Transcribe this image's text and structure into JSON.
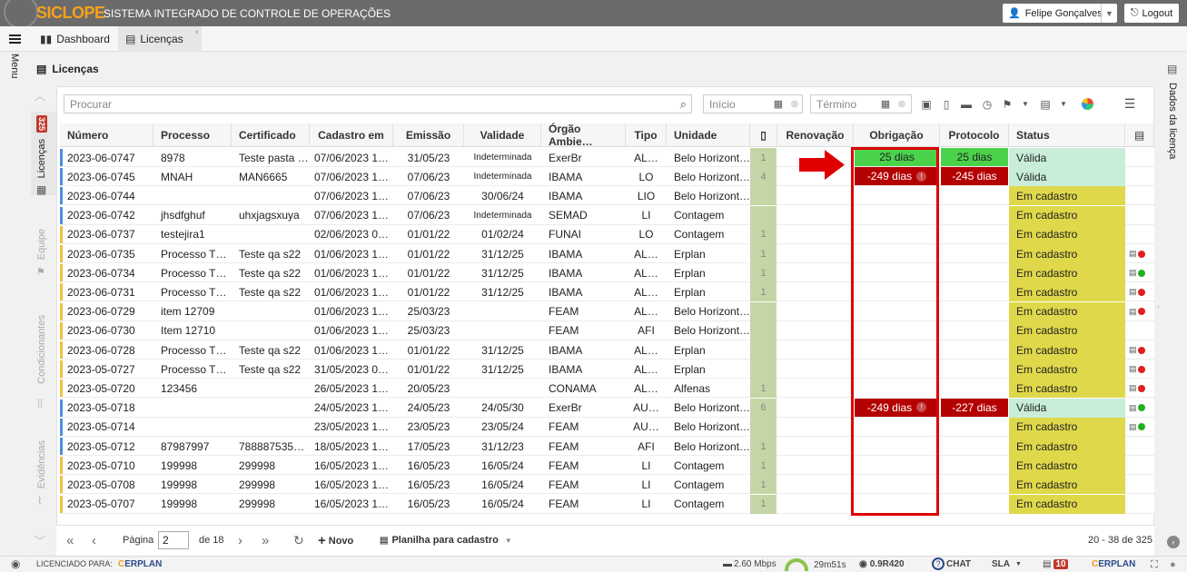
{
  "header": {
    "logo": "SICLOPE",
    "system_title": "SISTEMA INTEGRADO DE CONTROLE DE OPERAÇÕES",
    "user": "Felipe Gonçalves",
    "logout": "Logout"
  },
  "tabs": [
    {
      "label": "Dashboard"
    },
    {
      "label": "Licenças"
    }
  ],
  "menu_label": "Menu",
  "page_title": "Licenças",
  "left_panel": {
    "licencas": "Licenças",
    "licencas_badge": "325",
    "equipe": "Equipe",
    "condicionantes": "Condicionantes",
    "evidencias": "Evidências"
  },
  "right_panel": {
    "label": "Dados da licença"
  },
  "search": {
    "placeholder": "Procurar"
  },
  "filters": {
    "inicio": "Início",
    "termino": "Término"
  },
  "columns": [
    "Número",
    "Processo",
    "Certificado",
    "Cadastro em",
    "Emissão",
    "Validade",
    "Órgão Ambie…",
    "Tipo",
    "Unidade",
    "",
    "Renovação",
    "Obrigação",
    "Protocolo",
    "Status"
  ],
  "rows": [
    {
      "numero": "2023-06-0747",
      "processo": "8978",
      "certificado": "Teste pasta …",
      "cadastro": "07/06/2023 1…",
      "emissao": "31/05/23",
      "validade": "Indeterminada",
      "orgao": "ExerBr",
      "tipo": "AL…",
      "unidade": "Belo Horizont…",
      "n": "1",
      "obrigacao": "25 dias",
      "protocolo": "25 dias",
      "status": "Válida",
      "bar": "#4a90d9",
      "icon": ""
    },
    {
      "numero": "2023-06-0745",
      "processo": "MNAH",
      "certificado": "MAN6665",
      "cadastro": "07/06/2023 1…",
      "emissao": "07/06/23",
      "validade": "Indeterminada",
      "orgao": "IBAMA",
      "tipo": "LO",
      "unidade": "Belo Horizont…",
      "n": "4",
      "obrigacao": "-249 dias",
      "protocolo": "-245 dias",
      "status": "Válida",
      "bar": "#4a90d9",
      "icon": ""
    },
    {
      "numero": "2023-06-0744",
      "processo": "",
      "certificado": "",
      "cadastro": "07/06/2023 1…",
      "emissao": "07/06/23",
      "validade": "30/06/24",
      "orgao": "IBAMA",
      "tipo": "LIO",
      "unidade": "Belo Horizont…",
      "n": "",
      "obrigacao": "",
      "protocolo": "",
      "status": "Em cadastro",
      "bar": "#4a90d9",
      "icon": ""
    },
    {
      "numero": "2023-06-0742",
      "processo": "jhsdfghuf",
      "certificado": "uhxjagsxuya",
      "cadastro": "07/06/2023 1…",
      "emissao": "07/06/23",
      "validade": "Indeterminada",
      "orgao": "SEMAD",
      "tipo": "LI",
      "unidade": "Contagem",
      "n": "",
      "obrigacao": "",
      "protocolo": "",
      "status": "Em cadastro",
      "bar": "#4a90d9",
      "icon": ""
    },
    {
      "numero": "2023-06-0737",
      "processo": "testejira1",
      "certificado": "",
      "cadastro": "02/06/2023 0…",
      "emissao": "01/01/22",
      "validade": "01/02/24",
      "orgao": "FUNAI",
      "tipo": "LO",
      "unidade": "Contagem",
      "n": "1",
      "obrigacao": "",
      "protocolo": "",
      "status": "Em cadastro",
      "bar": "#f0c040",
      "icon": ""
    },
    {
      "numero": "2023-06-0735",
      "processo": "Processo T…",
      "certificado": "Teste qa s22",
      "cadastro": "01/06/2023 1…",
      "emissao": "01/01/22",
      "validade": "31/12/25",
      "orgao": "IBAMA",
      "tipo": "AL…",
      "unidade": "Erplan",
      "n": "1",
      "obrigacao": "",
      "protocolo": "",
      "status": "Em cadastro",
      "bar": "#f0c040",
      "icon": "red"
    },
    {
      "numero": "2023-06-0734",
      "processo": "Processo T…",
      "certificado": "Teste qa s22",
      "cadastro": "01/06/2023 1…",
      "emissao": "01/01/22",
      "validade": "31/12/25",
      "orgao": "IBAMA",
      "tipo": "AL…",
      "unidade": "Erplan",
      "n": "1",
      "obrigacao": "",
      "protocolo": "",
      "status": "Em cadastro",
      "bar": "#f0c040",
      "icon": "green"
    },
    {
      "numero": "2023-06-0731",
      "processo": "Processo T…",
      "certificado": "Teste qa s22",
      "cadastro": "01/06/2023 1…",
      "emissao": "01/01/22",
      "validade": "31/12/25",
      "orgao": "IBAMA",
      "tipo": "AL…",
      "unidade": "Erplan",
      "n": "1",
      "obrigacao": "",
      "protocolo": "",
      "status": "Em cadastro",
      "bar": "#f0c040",
      "icon": "red"
    },
    {
      "numero": "2023-06-0729",
      "processo": "item 12709",
      "certificado": "",
      "cadastro": "01/06/2023 1…",
      "emissao": "25/03/23",
      "validade": "",
      "orgao": "FEAM",
      "tipo": "AL…",
      "unidade": "Belo Horizont…",
      "n": "",
      "obrigacao": "",
      "protocolo": "",
      "status": "Em cadastro",
      "bar": "#f0c040",
      "icon": "red"
    },
    {
      "numero": "2023-06-0730",
      "processo": "Item 12710",
      "certificado": "",
      "cadastro": "01/06/2023 1…",
      "emissao": "25/03/23",
      "validade": "",
      "orgao": "FEAM",
      "tipo": "AFI",
      "unidade": "Belo Horizont…",
      "n": "",
      "obrigacao": "",
      "protocolo": "",
      "status": "Em cadastro",
      "bar": "#f0c040",
      "icon": ""
    },
    {
      "numero": "2023-06-0728",
      "processo": "Processo T…",
      "certificado": "Teste qa s22",
      "cadastro": "01/06/2023 1…",
      "emissao": "01/01/22",
      "validade": "31/12/25",
      "orgao": "IBAMA",
      "tipo": "AL…",
      "unidade": "Erplan",
      "n": "",
      "obrigacao": "",
      "protocolo": "",
      "status": "Em cadastro",
      "bar": "#f0c040",
      "icon": "red"
    },
    {
      "numero": "2023-05-0727",
      "processo": "Processo T…",
      "certificado": "Teste qa s22",
      "cadastro": "31/05/2023 0…",
      "emissao": "01/01/22",
      "validade": "31/12/25",
      "orgao": "IBAMA",
      "tipo": "AL…",
      "unidade": "Erplan",
      "n": "",
      "obrigacao": "",
      "protocolo": "",
      "status": "Em cadastro",
      "bar": "#f0c040",
      "icon": "red"
    },
    {
      "numero": "2023-05-0720",
      "processo": "123456",
      "certificado": "",
      "cadastro": "26/05/2023 1…",
      "emissao": "20/05/23",
      "validade": "",
      "orgao": "CONAMA",
      "tipo": "AL…",
      "unidade": "Alfenas",
      "n": "1",
      "obrigacao": "",
      "protocolo": "",
      "status": "Em cadastro",
      "bar": "#f0c040",
      "icon": "red"
    },
    {
      "numero": "2023-05-0718",
      "processo": "",
      "certificado": "",
      "cadastro": "24/05/2023 1…",
      "emissao": "24/05/23",
      "validade": "24/05/30",
      "orgao": "ExerBr",
      "tipo": "AU…",
      "unidade": "Belo Horizont…",
      "n": "6",
      "obrigacao": "-249 dias",
      "protocolo": "-227 dias",
      "status": "Válida",
      "bar": "#4a90d9",
      "icon": "green"
    },
    {
      "numero": "2023-05-0714",
      "processo": "",
      "certificado": "",
      "cadastro": "23/05/2023 1…",
      "emissao": "23/05/23",
      "validade": "23/05/24",
      "orgao": "FEAM",
      "tipo": "AU…",
      "unidade": "Belo Horizont…",
      "n": "",
      "obrigacao": "",
      "protocolo": "",
      "status": "Em cadastro",
      "bar": "#4a90d9",
      "icon": "green"
    },
    {
      "numero": "2023-05-0712",
      "processo": "87987997",
      "certificado": "788887535…",
      "cadastro": "18/05/2023 1…",
      "emissao": "17/05/23",
      "validade": "31/12/23",
      "orgao": "FEAM",
      "tipo": "AFI",
      "unidade": "Belo Horizont…",
      "n": "1",
      "obrigacao": "",
      "protocolo": "",
      "status": "Em cadastro",
      "bar": "#4a90d9",
      "icon": ""
    },
    {
      "numero": "2023-05-0710",
      "processo": "199998",
      "certificado": "299998",
      "cadastro": "16/05/2023 1…",
      "emissao": "16/05/23",
      "validade": "16/05/24",
      "orgao": "FEAM",
      "tipo": "LI",
      "unidade": "Contagem",
      "n": "1",
      "obrigacao": "",
      "protocolo": "",
      "status": "Em cadastro",
      "bar": "#f0c040",
      "icon": ""
    },
    {
      "numero": "2023-05-0708",
      "processo": "199998",
      "certificado": "299998",
      "cadastro": "16/05/2023 1…",
      "emissao": "16/05/23",
      "validade": "16/05/24",
      "orgao": "FEAM",
      "tipo": "LI",
      "unidade": "Contagem",
      "n": "1",
      "obrigacao": "",
      "protocolo": "",
      "status": "Em cadastro",
      "bar": "#f0c040",
      "icon": ""
    },
    {
      "numero": "2023-05-0707",
      "processo": "199998",
      "certificado": "299998",
      "cadastro": "16/05/2023 1…",
      "emissao": "16/05/23",
      "validade": "16/05/24",
      "orgao": "FEAM",
      "tipo": "LI",
      "unidade": "Contagem",
      "n": "1",
      "obrigacao": "",
      "protocolo": "",
      "status": "Em cadastro",
      "bar": "#f0c040",
      "icon": ""
    }
  ],
  "pagination": {
    "page_label": "Página",
    "page": "2",
    "of": "de 18",
    "novo": "Novo",
    "planilha": "Planilha para cadastro",
    "range": "20 - 38 de 325"
  },
  "statusbar": {
    "licenciado": "LICENCIADO PARA:",
    "brand": "ERPLAN",
    "speed": "2.60 Mbps",
    "timer": "29m51s",
    "version": "0.9R420",
    "chat": "CHAT",
    "sla": "SLA",
    "count": "10"
  },
  "colors": {
    "valid": "#c8edd8",
    "cadastro": "#dfd84a",
    "green_cell": "#4bd24b",
    "red_cell": "#b40000",
    "highlight": "#e00000"
  }
}
